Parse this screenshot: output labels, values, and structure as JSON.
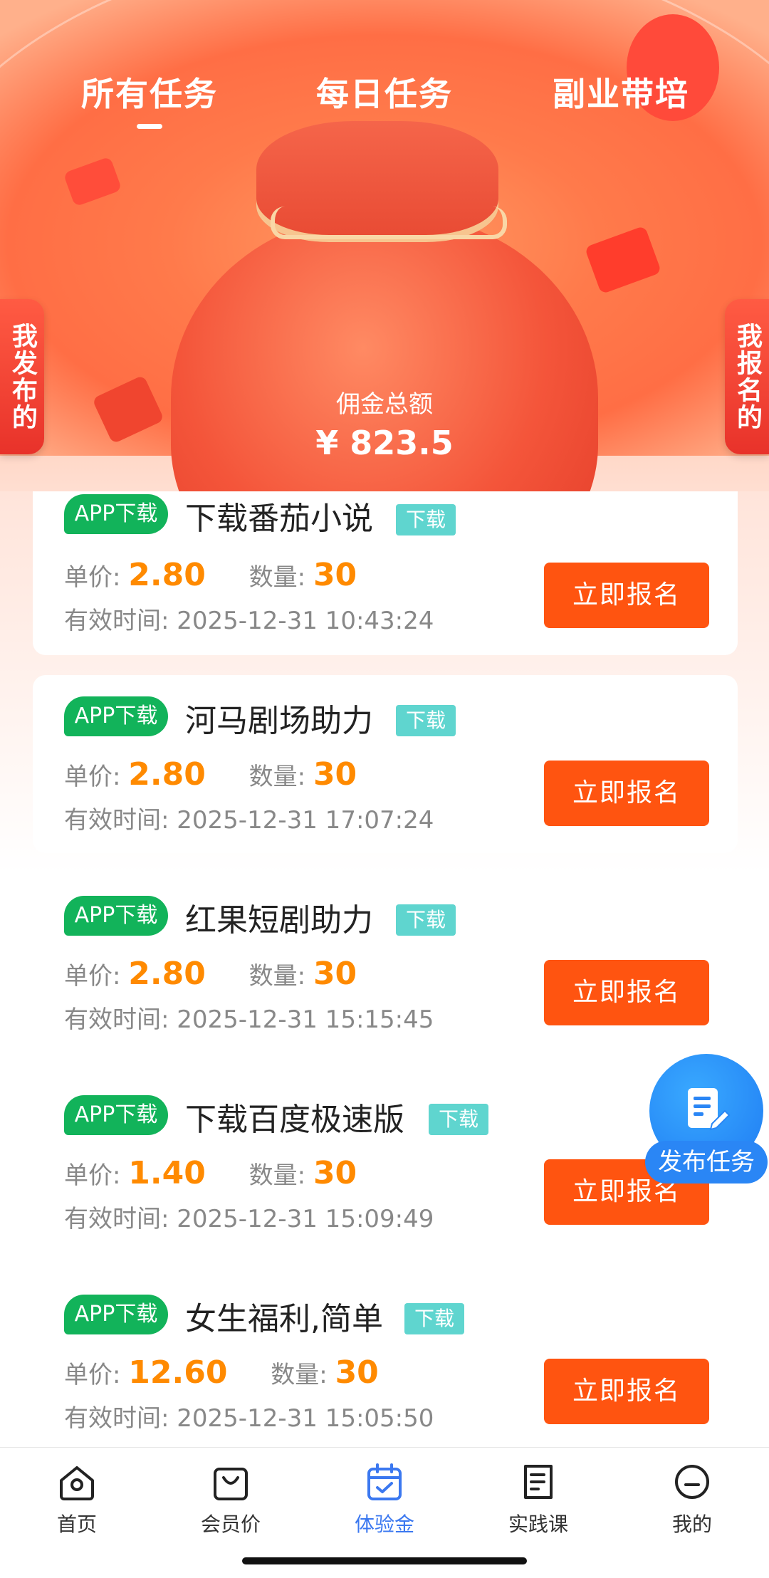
{
  "header": {
    "tabs": [
      {
        "label": "所有任务",
        "active": true
      },
      {
        "label": "每日任务",
        "active": false
      },
      {
        "label": "副业带培",
        "active": false
      }
    ],
    "left_side_tag": "我发布的",
    "right_side_tag": "我报名的",
    "commission_label": "佣金总额",
    "commission_amount": "¥ 823.5"
  },
  "tasks": [
    {
      "badge": "APP下载",
      "title": "下载番茄小说",
      "tag": "下载",
      "price_label": "单价:",
      "price": "2.80",
      "qty_label": "数量:",
      "qty": "30",
      "time_label": "有效时间:",
      "time": "2025-12-31 10:43:24",
      "button": "立即报名"
    },
    {
      "badge": "APP下载",
      "title": "河马剧场助力",
      "tag": "下载",
      "price_label": "单价:",
      "price": "2.80",
      "qty_label": "数量:",
      "qty": "30",
      "time_label": "有效时间:",
      "time": "2025-12-31 17:07:24",
      "button": "立即报名"
    },
    {
      "badge": "APP下载",
      "title": "红果短剧助力",
      "tag": "下载",
      "price_label": "单价:",
      "price": "2.80",
      "qty_label": "数量:",
      "qty": "30",
      "time_label": "有效时间:",
      "time": "2025-12-31 15:15:45",
      "button": "立即报名"
    },
    {
      "badge": "APP下载",
      "title": "下载百度极速版",
      "tag": "下载",
      "price_label": "单价:",
      "price": "1.40",
      "qty_label": "数量:",
      "qty": "30",
      "time_label": "有效时间:",
      "time": "2025-12-31 15:09:49",
      "button": "立即报名"
    },
    {
      "badge": "APP下载",
      "title": "女生福利,简单",
      "tag": "下载",
      "price_label": "单价:",
      "price": "12.60",
      "qty_label": "数量:",
      "qty": "30",
      "time_label": "有效时间:",
      "time": "2025-12-31 15:05:50",
      "button": "立即报名"
    }
  ],
  "fab": {
    "label": "发布任务",
    "icon": "document-edit-icon"
  },
  "bottom_nav": [
    {
      "label": "首页",
      "icon": "home-icon",
      "active": false
    },
    {
      "label": "会员价",
      "icon": "shopping-bag-icon",
      "active": false
    },
    {
      "label": "体验金",
      "icon": "calendar-check-icon",
      "active": true
    },
    {
      "label": "实践课",
      "icon": "document-icon",
      "active": false
    },
    {
      "label": "我的",
      "icon": "profile-icon",
      "active": false
    }
  ],
  "colors": {
    "accent_orange": "#ff5410",
    "price_orange": "#ff8a00",
    "badge_green": "#12b35a",
    "tag_teal": "#5fd5cf",
    "nav_active_blue": "#3b78f0"
  }
}
